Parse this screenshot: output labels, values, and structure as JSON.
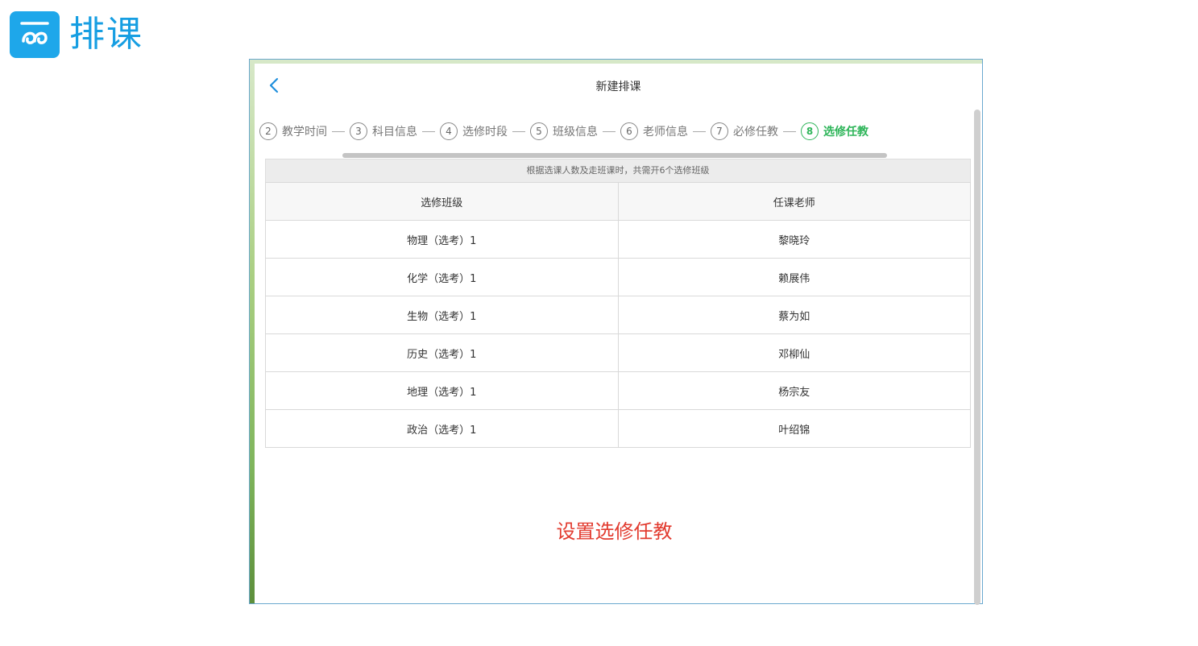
{
  "brand": {
    "title": "排课",
    "logo_icon": "wave-logo-icon",
    "color": "#169ee2"
  },
  "screen": {
    "title": "新建排课",
    "back_icon": "chevron-left-icon",
    "steps": [
      {
        "num": "2",
        "label": "教学时间",
        "active": false
      },
      {
        "num": "3",
        "label": "科目信息",
        "active": false
      },
      {
        "num": "4",
        "label": "选修时段",
        "active": false
      },
      {
        "num": "5",
        "label": "班级信息",
        "active": false
      },
      {
        "num": "6",
        "label": "老师信息",
        "active": false
      },
      {
        "num": "7",
        "label": "必修任教",
        "active": false
      },
      {
        "num": "8",
        "label": "选修任教",
        "active": true
      }
    ],
    "notice": "根据选课人数及走班课时，共需开6个选修班级",
    "table": {
      "headers": [
        "选修班级",
        "任课老师"
      ],
      "rows": [
        [
          "物理（选考）1",
          "黎晓玲"
        ],
        [
          "化学（选考）1",
          "赖展伟"
        ],
        [
          "生物（选考）1",
          "蔡为如"
        ],
        [
          "历史（选考）1",
          "邓柳仙"
        ],
        [
          "地理（选考）1",
          "杨宗友"
        ],
        [
          "政治（选考）1",
          "叶绍锦"
        ]
      ]
    },
    "caption": "设置选修任教",
    "accent_active": "#2fb55a",
    "caption_color": "#e23b2f"
  }
}
